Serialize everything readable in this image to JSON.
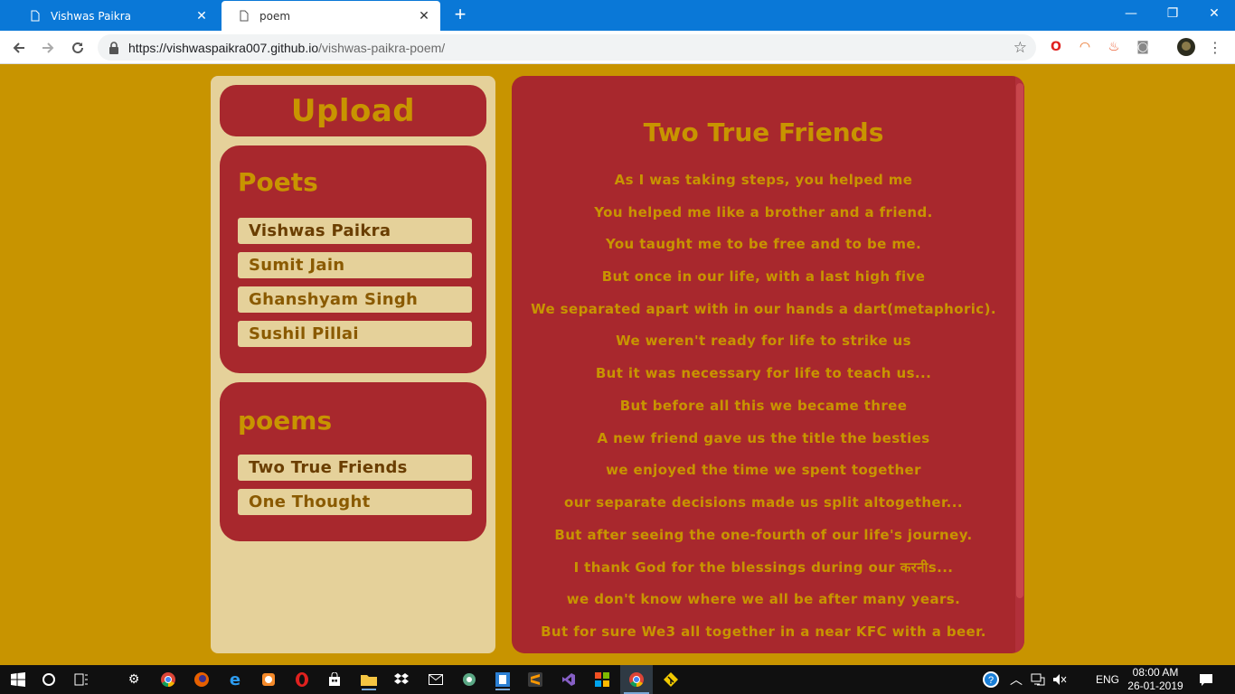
{
  "browser": {
    "tabs": [
      {
        "title": "Vishwas Paikra",
        "active": false
      },
      {
        "title": "poem",
        "active": true
      }
    ],
    "url_host": "https://vishwaspaikra007.github.io",
    "url_path": "/vishwas-paikra-poem/"
  },
  "sidebar": {
    "upload_label": "Upload",
    "poets_heading": "Poets",
    "poets": [
      "Vishwas Paikra",
      "Sumit Jain",
      "Ghanshyam Singh",
      "Sushil Pillai"
    ],
    "poems_heading": "poems",
    "poems": [
      "Two True Friends",
      "One Thought"
    ]
  },
  "poem": {
    "title": "Two True Friends",
    "lines": [
      "As I was taking steps, you helped me",
      "You helped me like a brother and a friend.",
      "You taught me to be free and to be me.",
      "But once in our life, with a last high five",
      "We separated apart with in our hands a dart(metaphoric).",
      "We weren't ready for life to strike us",
      "But it was necessary for life to teach us...",
      "But before all this we became three",
      "A new friend gave us the title the besties",
      "we enjoyed the time we spent together",
      "our separate decisions made us split altogether...",
      "But after seeing the one-fourth of our life's journey.",
      "I thank God for the blessings during our करनीs...",
      "we don't know where we all be after many years.",
      "But for sure We3 all together in a near KFC with a beer."
    ]
  },
  "taskbar": {
    "language": "ENG",
    "time": "08:00 AM",
    "date": "26-01-2019"
  },
  "colors": {
    "background": "#c89400",
    "panel": "#a8282d",
    "sidebar": "#e5d19a",
    "accent_text": "#c89400"
  }
}
